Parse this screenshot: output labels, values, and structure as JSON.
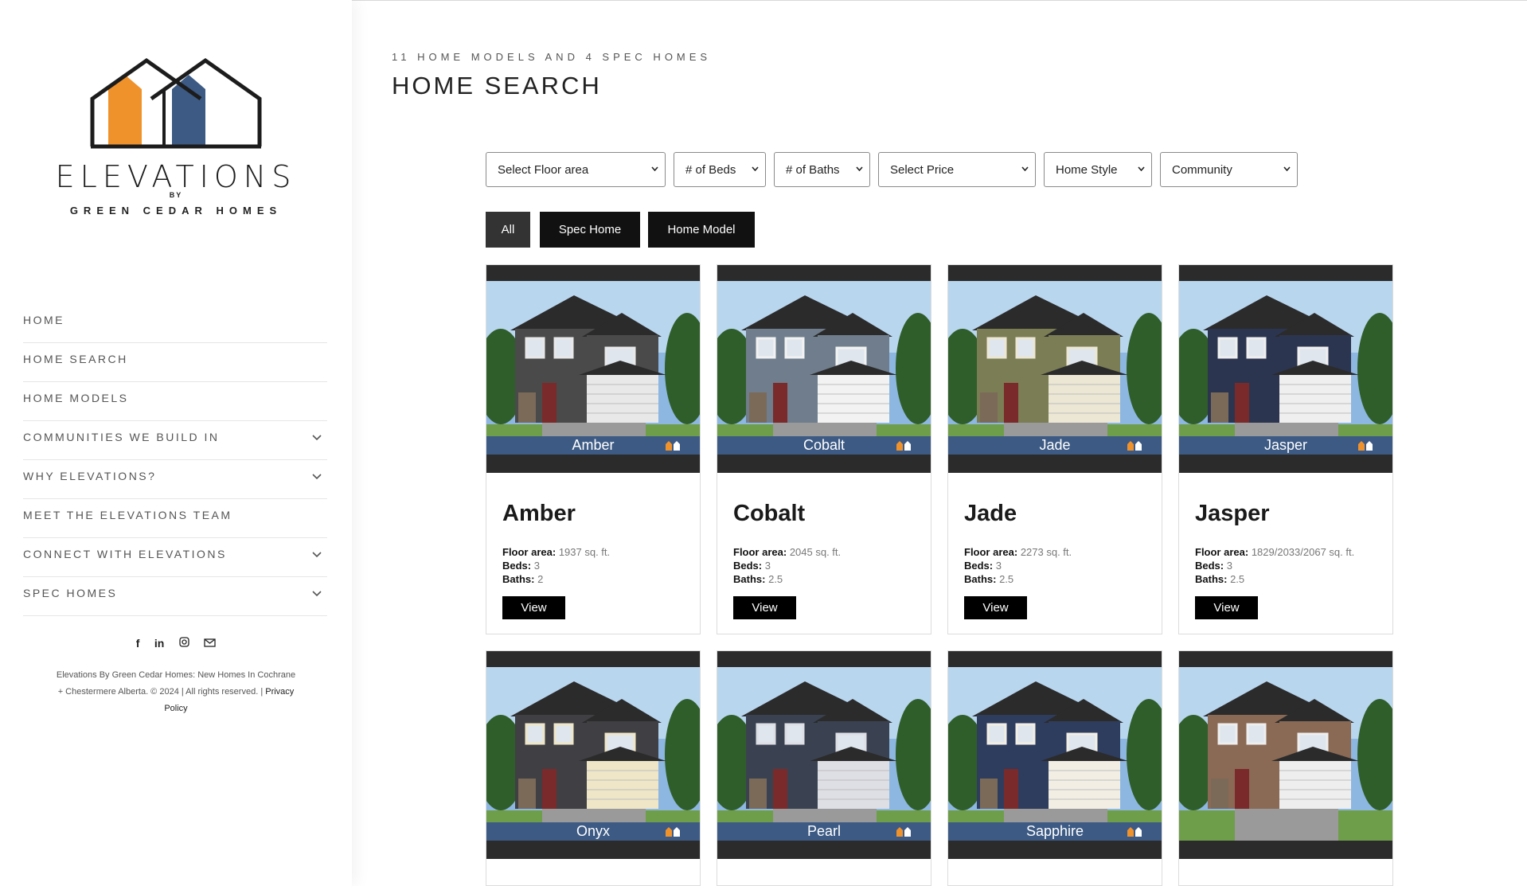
{
  "brand": {
    "word": "ELEVATIONS",
    "by": "BY",
    "sub": "GREEN CEDAR HOMES",
    "colors": {
      "orange": "#f0922b",
      "blue": "#3c5a84",
      "dark": "#1c1c1c"
    }
  },
  "nav": [
    {
      "label": "HOME",
      "has_submenu": false
    },
    {
      "label": "HOME SEARCH",
      "has_submenu": false
    },
    {
      "label": "HOME MODELS",
      "has_submenu": false
    },
    {
      "label": "COMMUNITIES WE BUILD IN",
      "has_submenu": true
    },
    {
      "label": "WHY ELEVATIONS?",
      "has_submenu": true
    },
    {
      "label": "MEET THE ELEVATIONS TEAM",
      "has_submenu": false
    },
    {
      "label": "CONNECT WITH ELEVATIONS",
      "has_submenu": true
    },
    {
      "label": "SPEC HOMES",
      "has_submenu": true
    }
  ],
  "social": {
    "facebook": "f",
    "linkedin": "in",
    "instagram": "instagram-icon",
    "email": "mail-icon"
  },
  "footer": {
    "line1": "Elevations By Green Cedar Homes: New Homes In Cochrane",
    "line2": "+ Chestermere Alberta. © 2024 | All rights reserved. |",
    "privacy_a": "Privacy",
    "privacy_b": "Policy"
  },
  "header": {
    "eyebrow": "11 HOME MODELS AND 4 SPEC HOMES",
    "title": "HOME SEARCH"
  },
  "filters": {
    "floor_area": "Select Floor area",
    "beds": "# of Beds",
    "baths": "# of Baths",
    "price": "Select Price",
    "style": "Home Style",
    "community": "Community"
  },
  "tabs": {
    "all": "All",
    "spec": "Spec Home",
    "model": "Home Model",
    "active": "All"
  },
  "labels": {
    "floor": "Floor area:",
    "beds": "Beds:",
    "baths": "Baths:",
    "view": "View"
  },
  "homes": [
    {
      "name": "Amber",
      "floor": "1937 sq. ft.",
      "beds": "3",
      "baths": "2",
      "siding": "#4a4a4a",
      "trim": "#e8e8e8"
    },
    {
      "name": "Cobalt",
      "floor": "2045 sq. ft.",
      "beds": "3",
      "baths": "2.5",
      "siding": "#6f7d8c",
      "trim": "#f2f2f2"
    },
    {
      "name": "Jade",
      "floor": "2273 sq. ft.",
      "beds": "3",
      "baths": "2.5",
      "siding": "#7b7d55",
      "trim": "#ece7d4"
    },
    {
      "name": "Jasper",
      "floor": "1829/2033/2067 sq. ft.",
      "beds": "3",
      "baths": "2.5",
      "siding": "#2c3550",
      "trim": "#efefef"
    },
    {
      "name": "Onyx",
      "siding": "#3f3f44",
      "trim": "#efe6c8"
    },
    {
      "name": "Pearl",
      "siding": "#3a4252",
      "trim": "#dedfe5"
    },
    {
      "name": "Sapphire",
      "siding": "#2e3c5e",
      "trim": "#f2eee4"
    },
    {
      "name": "",
      "siding": "#8a6a55",
      "trim": "#eeeeee"
    }
  ]
}
